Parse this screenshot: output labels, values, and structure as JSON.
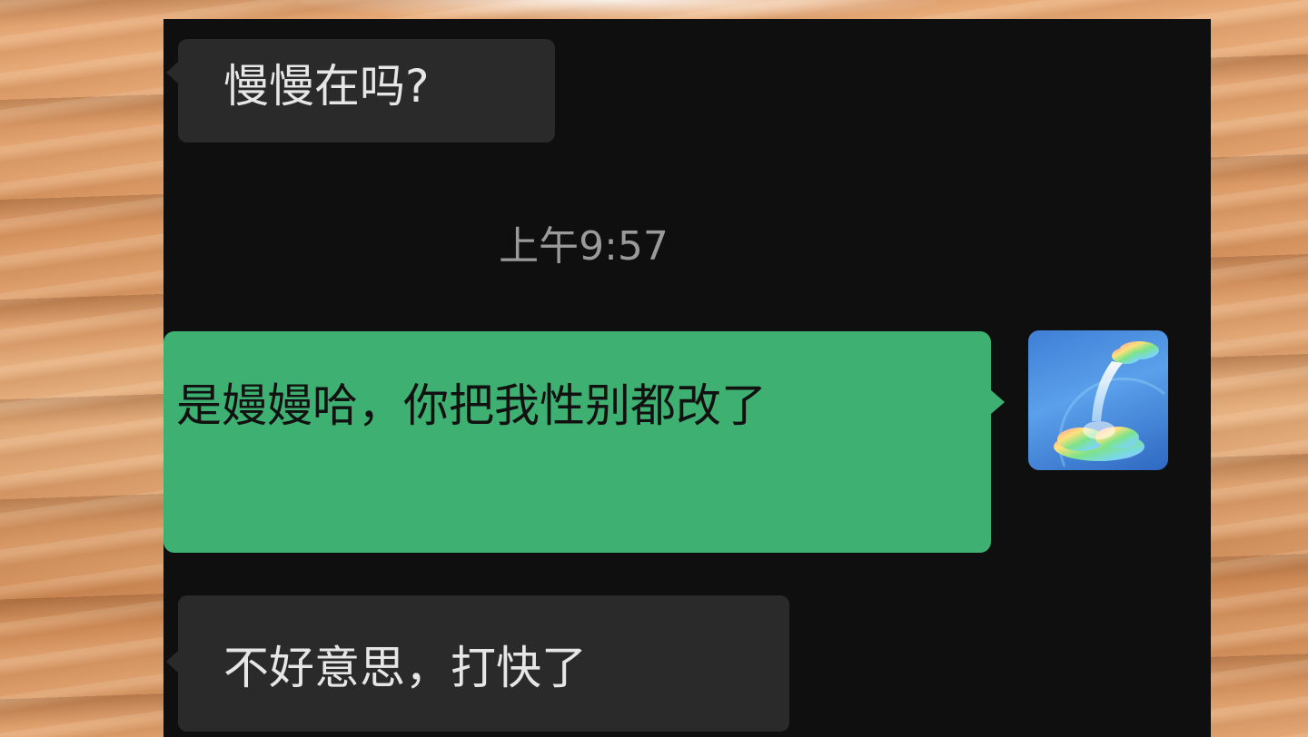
{
  "chat": {
    "messages": [
      {
        "direction": "incoming",
        "text": "慢慢在吗?"
      },
      {
        "direction": "timestamp",
        "text": "上午9:57"
      },
      {
        "direction": "outgoing",
        "text": "是嫚嫚哈，你把我性别都改了"
      },
      {
        "direction": "incoming",
        "text": "不好意思，打快了"
      }
    ]
  },
  "avatar": {
    "icon": "rainbow-cloud-waterfall-avatar"
  },
  "colors": {
    "incoming_bubble": "#2a2a2a",
    "outgoing_bubble": "#3eb172",
    "chat_background": "#0f0f0f",
    "timestamp_text": "#9a9a9a"
  }
}
